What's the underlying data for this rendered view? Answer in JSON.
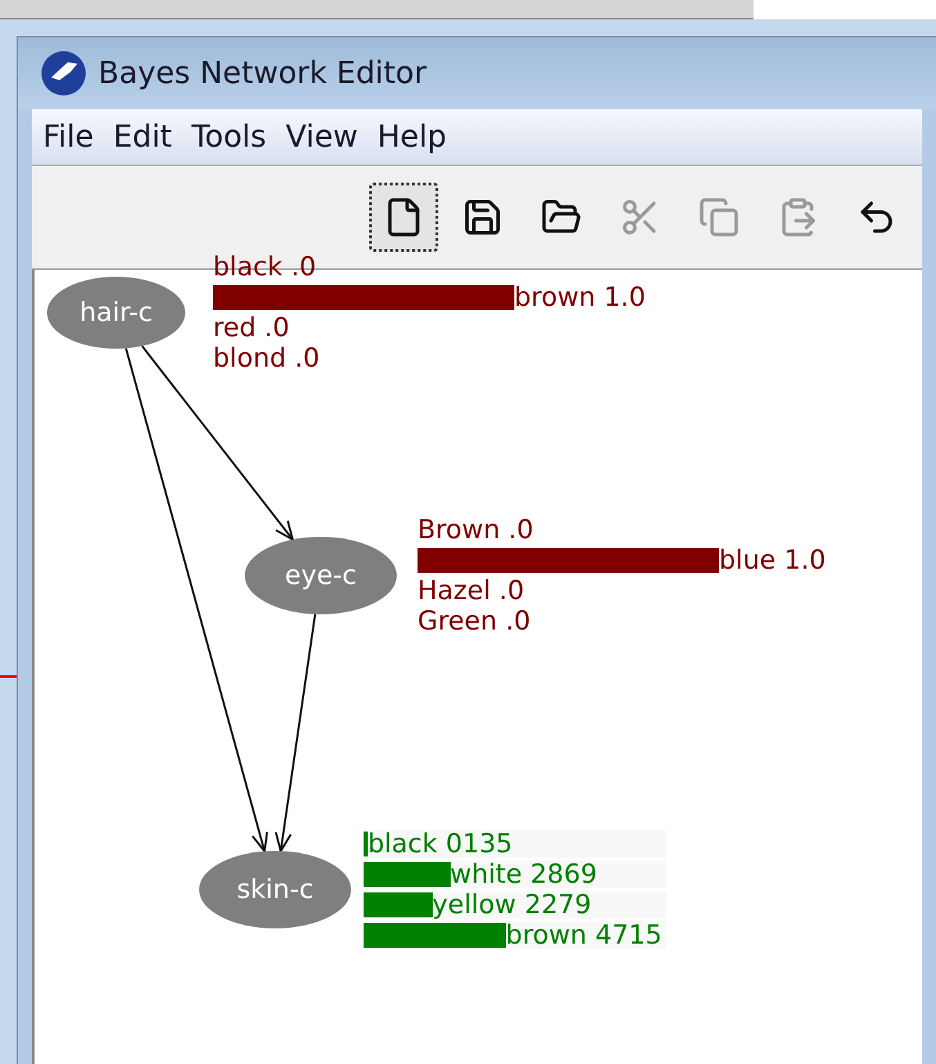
{
  "window": {
    "title": "Bayes Network Editor"
  },
  "menu": [
    "File",
    "Edit",
    "Tools",
    "View",
    "Help"
  ],
  "toolbar": [
    {
      "kind": "new",
      "selected": true,
      "disabled": false
    },
    {
      "kind": "save",
      "selected": false,
      "disabled": false
    },
    {
      "kind": "open",
      "selected": false,
      "disabled": false
    },
    {
      "kind": "cut",
      "selected": false,
      "disabled": true
    },
    {
      "kind": "copy",
      "selected": false,
      "disabled": true
    },
    {
      "kind": "paste",
      "selected": false,
      "disabled": true
    },
    {
      "kind": "undo",
      "selected": false,
      "disabled": false
    }
  ],
  "nodes": [
    {
      "name": "hair-c",
      "color": "#800000",
      "states": [
        {
          "label": "black .0"
        },
        {
          "label": "brown 1.0",
          "level": 1
        },
        {
          "label": "red .0"
        },
        {
          "label": "blond .0"
        }
      ]
    },
    {
      "name": "eye-c",
      "color": "#800000",
      "states": [
        {
          "label": "Brown .0"
        },
        {
          "label": "blue 1.0",
          "level": 1
        },
        {
          "label": "Hazel .0"
        },
        {
          "label": "Green .0"
        }
      ]
    },
    {
      "name": "skin-c",
      "color": "#008000",
      "states": [
        {
          "label": "black 0135",
          "level": 0.0135
        },
        {
          "label": "white 2869",
          "level": 0.2869
        },
        {
          "label": "yellow 2279",
          "level": 0.2279
        },
        {
          "label": "brown 4715",
          "level": 0.4715
        }
      ]
    }
  ]
}
